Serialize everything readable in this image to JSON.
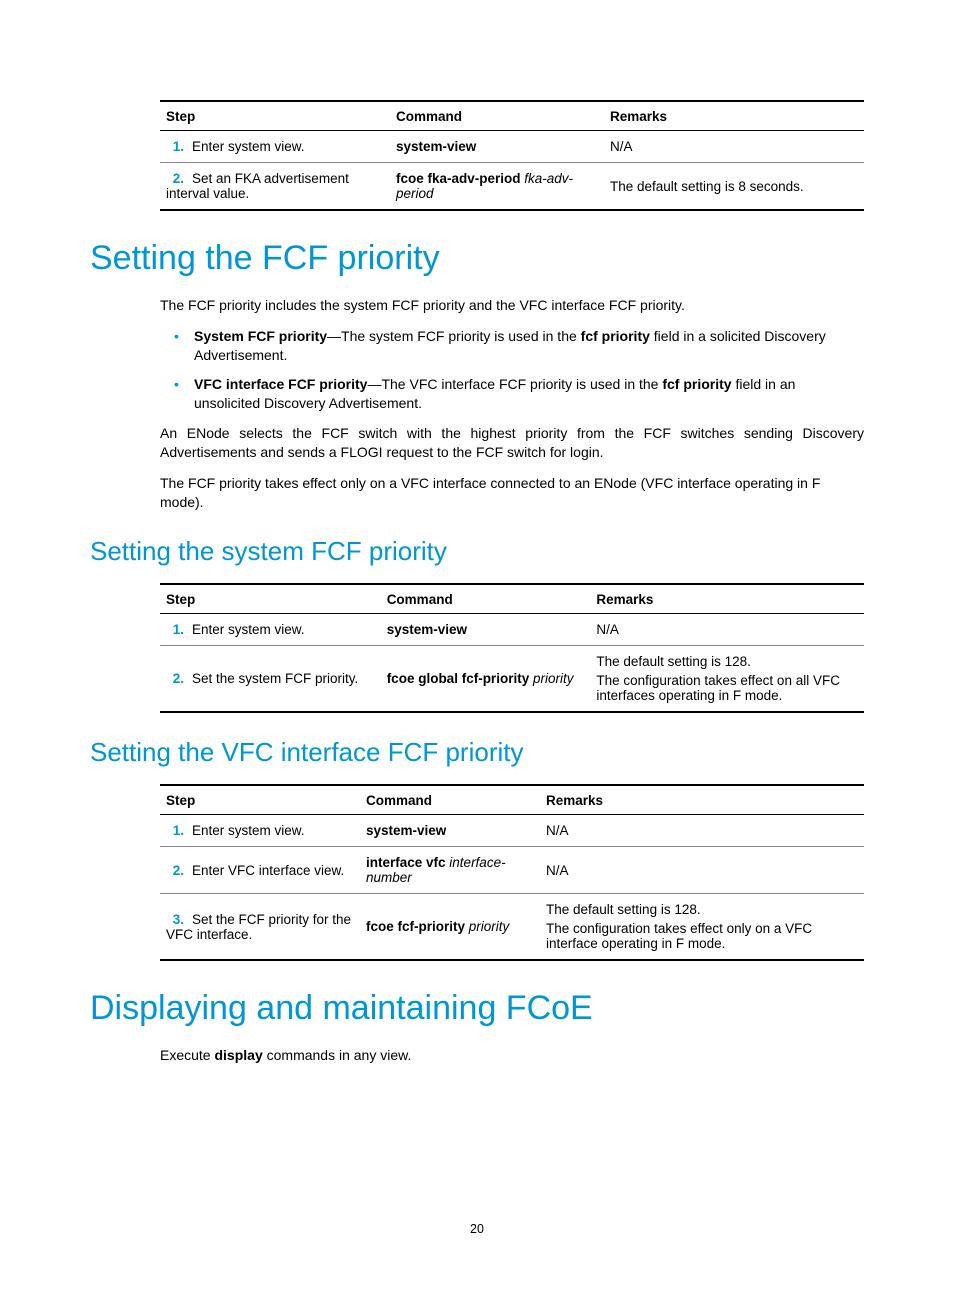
{
  "page_number": "20",
  "table1": {
    "headers": {
      "step": "Step",
      "command": "Command",
      "remarks": "Remarks"
    },
    "rows": [
      {
        "num": "1.",
        "step": "Enter system view.",
        "cmd_b": "system-view",
        "cmd_i": "",
        "remarks": "N/A"
      },
      {
        "num": "2.",
        "step": "Set an FKA advertisement interval value.",
        "cmd_b": "fcoe fka-adv-period",
        "cmd_i": " fka-adv-period",
        "remarks": "The default setting is 8 seconds."
      }
    ]
  },
  "h1_1": "Setting the FCF priority",
  "intro1": "The FCF priority includes the system FCF priority and the VFC interface FCF priority.",
  "bullets": [
    {
      "b": "System FCF priority",
      "dash": "—The system FCF priority is used in the ",
      "b2": "fcf priority",
      "rest": " field in a solicited Discovery Advertisement."
    },
    {
      "b": "VFC interface FCF priority",
      "dash": "—The VFC interface FCF priority is used in the ",
      "b2": "fcf priority",
      "rest": " field in an unsolicited Discovery Advertisement."
    }
  ],
  "para2": "An ENode selects the FCF switch with the highest priority from the FCF switches sending Discovery Advertisements and sends a FLOGI request to the FCF switch for login.",
  "para3": "The FCF priority takes effect only on a VFC interface connected to an ENode (VFC interface operating in F mode).",
  "h2_1": "Setting the system FCF priority",
  "table2": {
    "headers": {
      "step": "Step",
      "command": "Command",
      "remarks": "Remarks"
    },
    "rows": [
      {
        "num": "1.",
        "step": "Enter system view.",
        "cmd_b": "system-view",
        "cmd_i": "",
        "rem1": "N/A",
        "rem2": ""
      },
      {
        "num": "2.",
        "step": "Set the system FCF priority.",
        "cmd_b": "fcoe global fcf-priority",
        "cmd_i": " priority",
        "rem1": "The default setting is 128.",
        "rem2": "The configuration takes effect on all VFC interfaces operating in F mode."
      }
    ]
  },
  "h2_2": "Setting the VFC interface FCF priority",
  "table3": {
    "headers": {
      "step": "Step",
      "command": "Command",
      "remarks": "Remarks"
    },
    "rows": [
      {
        "num": "1.",
        "step": "Enter system view.",
        "cmd_b": "system-view",
        "cmd_i": "",
        "rem1": "N/A",
        "rem2": ""
      },
      {
        "num": "2.",
        "step": "Enter VFC interface view.",
        "cmd_b": "interface vfc",
        "cmd_i": " interface-number",
        "rem1": "N/A",
        "rem2": ""
      },
      {
        "num": "3.",
        "step": "Set the FCF priority for the VFC interface.",
        "cmd_b": "fcoe fcf-priority",
        "cmd_i": " priority",
        "rem1": "The default setting is 128.",
        "rem2": "The configuration takes effect only on a VFC interface operating in F mode."
      }
    ]
  },
  "h1_2": "Displaying and maintaining FCoE",
  "para4_pre": "Execute ",
  "para4_b": "display",
  "para4_post": " commands in any view."
}
